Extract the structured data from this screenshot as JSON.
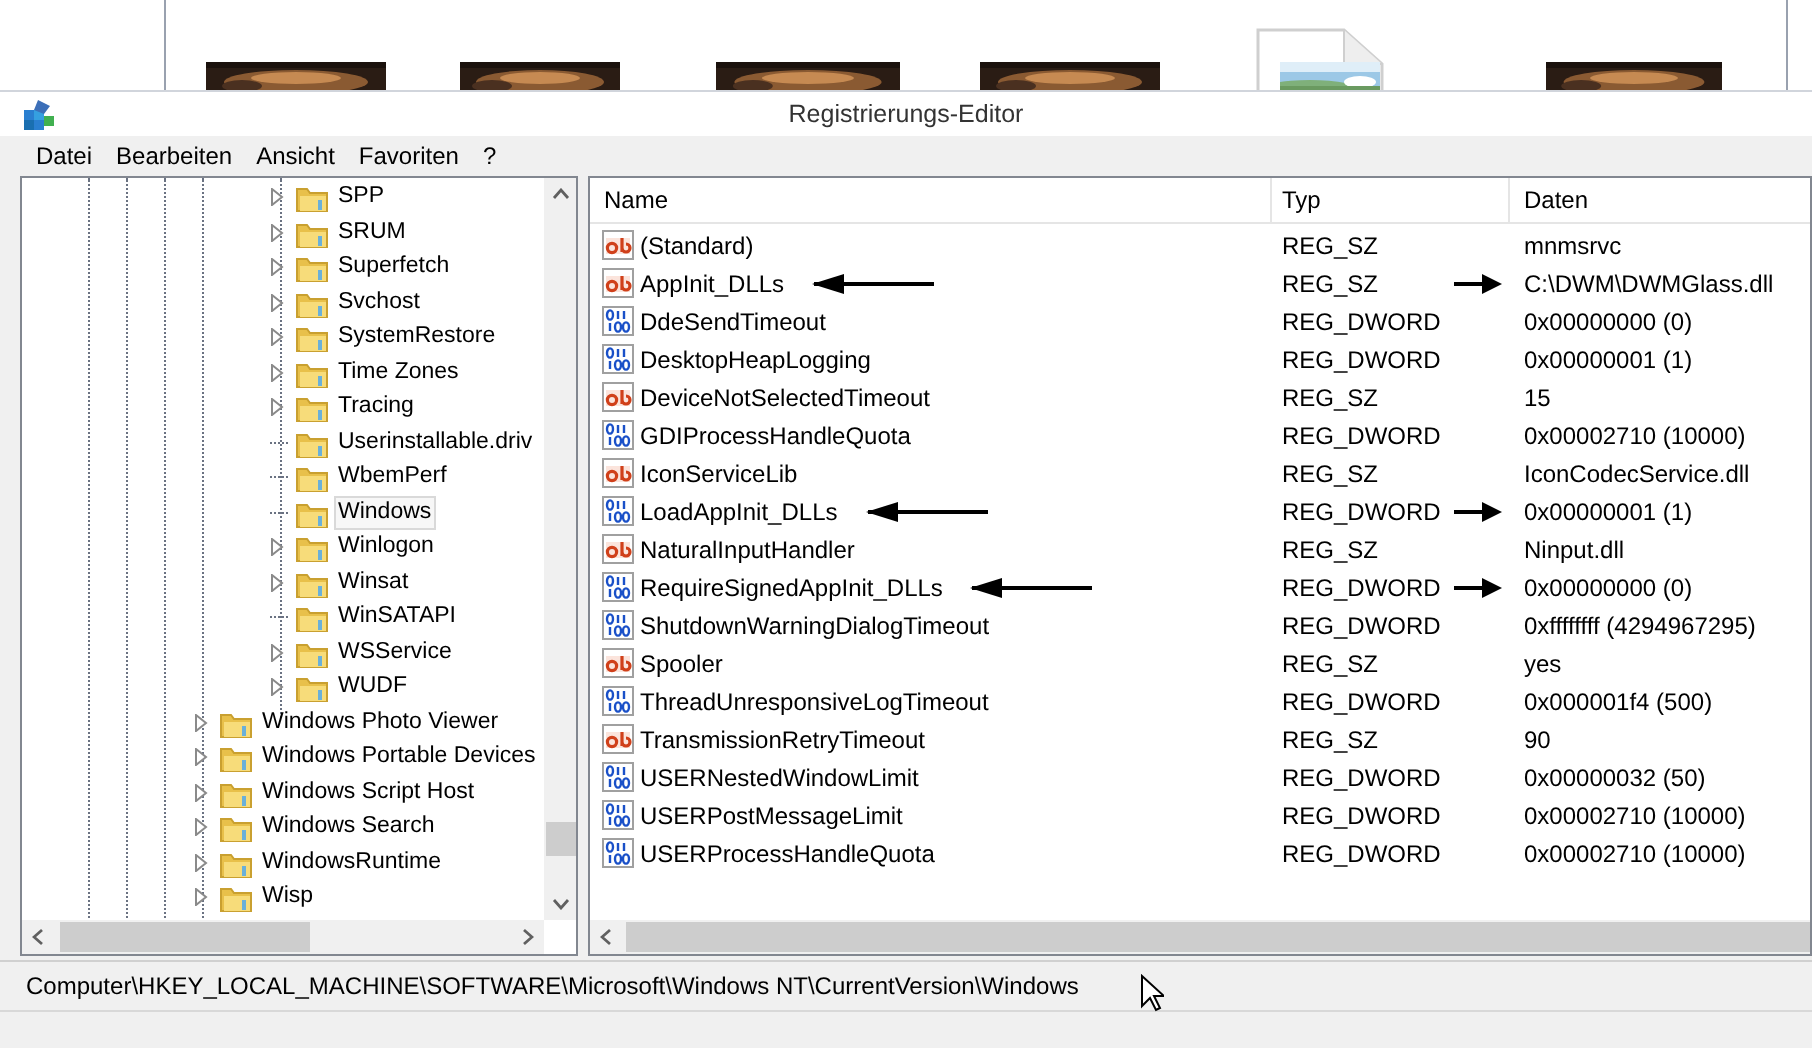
{
  "background": {
    "thumbnails": [
      {
        "kind": "picture"
      },
      {
        "kind": "picture"
      },
      {
        "kind": "picture"
      },
      {
        "kind": "picture"
      },
      {
        "kind": "picture"
      },
      {
        "kind": "picture"
      }
    ]
  },
  "window": {
    "title": "Registrierungs-Editor"
  },
  "menu": [
    "Datei",
    "Bearbeiten",
    "Ansicht",
    "Favoriten",
    "?"
  ],
  "tree": {
    "items": [
      {
        "children": [
          {
            "label": "SPP",
            "expandable": true,
            "selected": false
          },
          {
            "label": "SRUM",
            "expandable": true,
            "selected": false
          },
          {
            "label": "Superfetch",
            "expandable": true,
            "selected": false
          },
          {
            "label": "Svchost",
            "expandable": true,
            "selected": false
          },
          {
            "label": "SystemRestore",
            "expandable": true,
            "selected": false
          },
          {
            "label": "Time Zones",
            "expandable": true,
            "selected": false
          },
          {
            "label": "Tracing",
            "expandable": true,
            "selected": false
          },
          {
            "label": "Userinstallable.driv",
            "expandable": false,
            "selected": false
          },
          {
            "label": "WbemPerf",
            "expandable": false,
            "selected": false
          },
          {
            "label": "Windows",
            "expandable": false,
            "selected": true
          },
          {
            "label": "Winlogon",
            "expandable": true,
            "selected": false
          },
          {
            "label": "Winsat",
            "expandable": true,
            "selected": false
          },
          {
            "label": "WinSATAPI",
            "expandable": false,
            "selected": false
          },
          {
            "label": "WSService",
            "expandable": true,
            "selected": false
          },
          {
            "label": "WUDF",
            "expandable": true,
            "selected": false
          }
        ]
      },
      {
        "label": "Windows Photo Viewer",
        "expandable": true,
        "selected": false
      },
      {
        "label": "Windows Portable Devices",
        "expandable": true,
        "selected": false
      },
      {
        "label": "Windows Script Host",
        "expandable": true,
        "selected": false
      },
      {
        "label": "Windows Search",
        "expandable": true,
        "selected": false
      },
      {
        "label": "WindowsRuntime",
        "expandable": true,
        "selected": false
      },
      {
        "label": "Wisp",
        "expandable": true,
        "selected": false
      }
    ]
  },
  "table": {
    "columns": [
      "Name",
      "Typ",
      "Daten"
    ],
    "rows": [
      {
        "kind": "string",
        "name": "(Standard)",
        "type": "REG_SZ",
        "data": "mnmsrvc",
        "arrow": false
      },
      {
        "kind": "string",
        "name": "AppInit_DLLs",
        "type": "REG_SZ",
        "data": "C:\\DWM\\DWMGlass.dll",
        "arrow": true
      },
      {
        "kind": "binary",
        "name": "DdeSendTimeout",
        "type": "REG_DWORD",
        "data": "0x00000000 (0)",
        "arrow": false
      },
      {
        "kind": "binary",
        "name": "DesktopHeapLogging",
        "type": "REG_DWORD",
        "data": "0x00000001 (1)",
        "arrow": false
      },
      {
        "kind": "string",
        "name": "DeviceNotSelectedTimeout",
        "type": "REG_SZ",
        "data": "15",
        "arrow": false
      },
      {
        "kind": "binary",
        "name": "GDIProcessHandleQuota",
        "type": "REG_DWORD",
        "data": "0x00002710 (10000)",
        "arrow": false
      },
      {
        "kind": "string",
        "name": "IconServiceLib",
        "type": "REG_SZ",
        "data": "IconCodecService.dll",
        "arrow": false
      },
      {
        "kind": "binary",
        "name": "LoadAppInit_DLLs",
        "type": "REG_DWORD",
        "data": "0x00000001 (1)",
        "arrow": true
      },
      {
        "kind": "string",
        "name": "NaturalInputHandler",
        "type": "REG_SZ",
        "data": "Ninput.dll",
        "arrow": false
      },
      {
        "kind": "binary",
        "name": "RequireSignedAppInit_DLLs",
        "type": "REG_DWORD",
        "data": "0x00000000 (0)",
        "arrow": true
      },
      {
        "kind": "binary",
        "name": "ShutdownWarningDialogTimeout",
        "type": "REG_DWORD",
        "data": "0xffffffff (4294967295)",
        "arrow": false
      },
      {
        "kind": "string",
        "name": "Spooler",
        "type": "REG_SZ",
        "data": "yes",
        "arrow": false
      },
      {
        "kind": "binary",
        "name": "ThreadUnresponsiveLogTimeout",
        "type": "REG_DWORD",
        "data": "0x000001f4 (500)",
        "arrow": false
      },
      {
        "kind": "string",
        "name": "TransmissionRetryTimeout",
        "type": "REG_SZ",
        "data": "90",
        "arrow": false
      },
      {
        "kind": "binary",
        "name": "USERNestedWindowLimit",
        "type": "REG_DWORD",
        "data": "0x00000032 (50)",
        "arrow": false
      },
      {
        "kind": "binary",
        "name": "USERPostMessageLimit",
        "type": "REG_DWORD",
        "data": "0x00002710 (10000)",
        "arrow": false
      },
      {
        "kind": "binary",
        "name": "USERProcessHandleQuota",
        "type": "REG_DWORD",
        "data": "0x00002710 (10000)",
        "arrow": false
      }
    ]
  },
  "status_bar": "Computer\\HKEY_LOCAL_MACHINE\\SOFTWARE\\Microsoft\\Windows NT\\CurrentVersion\\Windows"
}
